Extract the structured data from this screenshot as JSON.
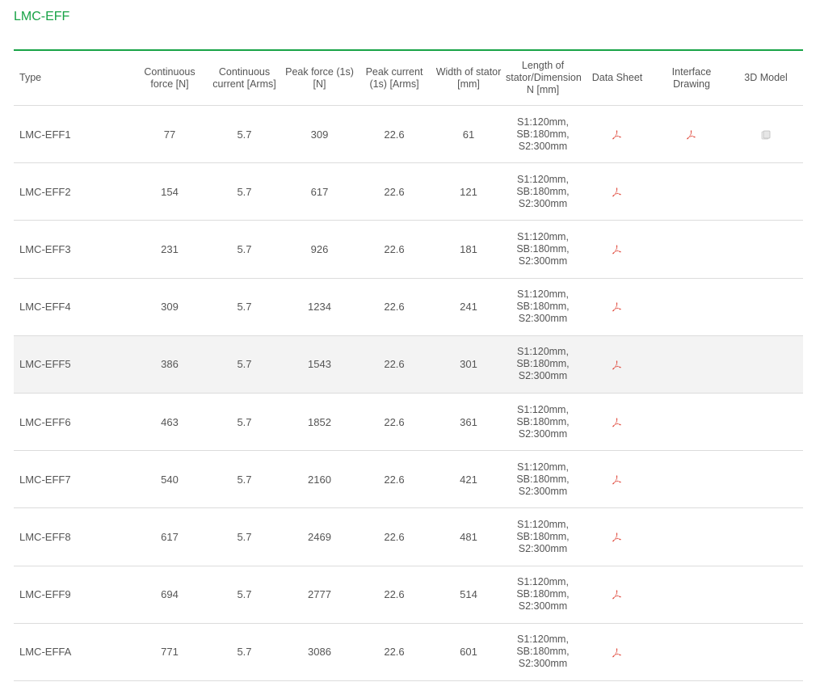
{
  "page_title": "LMC-EFF",
  "colors": {
    "accent": "#18a346",
    "pdf_icon": "#e0483b",
    "row_highlight": "#f3f3f3"
  },
  "headers": {
    "type": "Type",
    "cont_force": "Continuous force [N]",
    "cont_current": "Continuous current [Arms]",
    "peak_force": "Peak force (1s) [N]",
    "peak_current": "Peak current (1s) [Arms]",
    "stator_width": "Width of stator [mm]",
    "length": "Length of stator/Dimension N [mm]",
    "data_sheet": "Data Sheet",
    "interface_drawing": "Interface Drawing",
    "model_3d": "3D Model"
  },
  "rows": [
    {
      "type": "LMC-EFF1",
      "cont_force": "77",
      "cont_current": "5.7",
      "peak_force": "309",
      "peak_current": "22.6",
      "width": "61",
      "length": "S1:120mm, SB:180mm, S2:300mm",
      "data_sheet_icon": "pdf-icon",
      "interface_icon": "pdf-icon",
      "model_icon": "3d-model-icon"
    },
    {
      "type": "LMC-EFF2",
      "cont_force": "154",
      "cont_current": "5.7",
      "peak_force": "617",
      "peak_current": "22.6",
      "width": "121",
      "length": "S1:120mm, SB:180mm, S2:300mm",
      "data_sheet_icon": "pdf-icon"
    },
    {
      "type": "LMC-EFF3",
      "cont_force": "231",
      "cont_current": "5.7",
      "peak_force": "926",
      "peak_current": "22.6",
      "width": "181",
      "length": "S1:120mm, SB:180mm, S2:300mm",
      "data_sheet_icon": "pdf-icon"
    },
    {
      "type": "LMC-EFF4",
      "cont_force": "309",
      "cont_current": "5.7",
      "peak_force": "1234",
      "peak_current": "22.6",
      "width": "241",
      "length": "S1:120mm, SB:180mm, S2:300mm",
      "data_sheet_icon": "pdf-icon"
    },
    {
      "type": "LMC-EFF5",
      "cont_force": "386",
      "cont_current": "5.7",
      "peak_force": "1543",
      "peak_current": "22.6",
      "width": "301",
      "length": "S1:120mm, SB:180mm, S2:300mm",
      "data_sheet_icon": "pdf-icon",
      "highlighted": true
    },
    {
      "type": "LMC-EFF6",
      "cont_force": "463",
      "cont_current": "5.7",
      "peak_force": "1852",
      "peak_current": "22.6",
      "width": "361",
      "length": "S1:120mm, SB:180mm, S2:300mm",
      "data_sheet_icon": "pdf-icon"
    },
    {
      "type": "LMC-EFF7",
      "cont_force": "540",
      "cont_current": "5.7",
      "peak_force": "2160",
      "peak_current": "22.6",
      "width": "421",
      "length": "S1:120mm, SB:180mm, S2:300mm",
      "data_sheet_icon": "pdf-icon"
    },
    {
      "type": "LMC-EFF8",
      "cont_force": "617",
      "cont_current": "5.7",
      "peak_force": "2469",
      "peak_current": "22.6",
      "width": "481",
      "length": "S1:120mm, SB:180mm, S2:300mm",
      "data_sheet_icon": "pdf-icon"
    },
    {
      "type": "LMC-EFF9",
      "cont_force": "694",
      "cont_current": "5.7",
      "peak_force": "2777",
      "peak_current": "22.6",
      "width": "514",
      "length": "S1:120mm, SB:180mm, S2:300mm",
      "data_sheet_icon": "pdf-icon"
    },
    {
      "type": "LMC-EFFA",
      "cont_force": "771",
      "cont_current": "5.7",
      "peak_force": "3086",
      "peak_current": "22.6",
      "width": "601",
      "length": "S1:120mm, SB:180mm, S2:300mm",
      "data_sheet_icon": "pdf-icon"
    }
  ]
}
